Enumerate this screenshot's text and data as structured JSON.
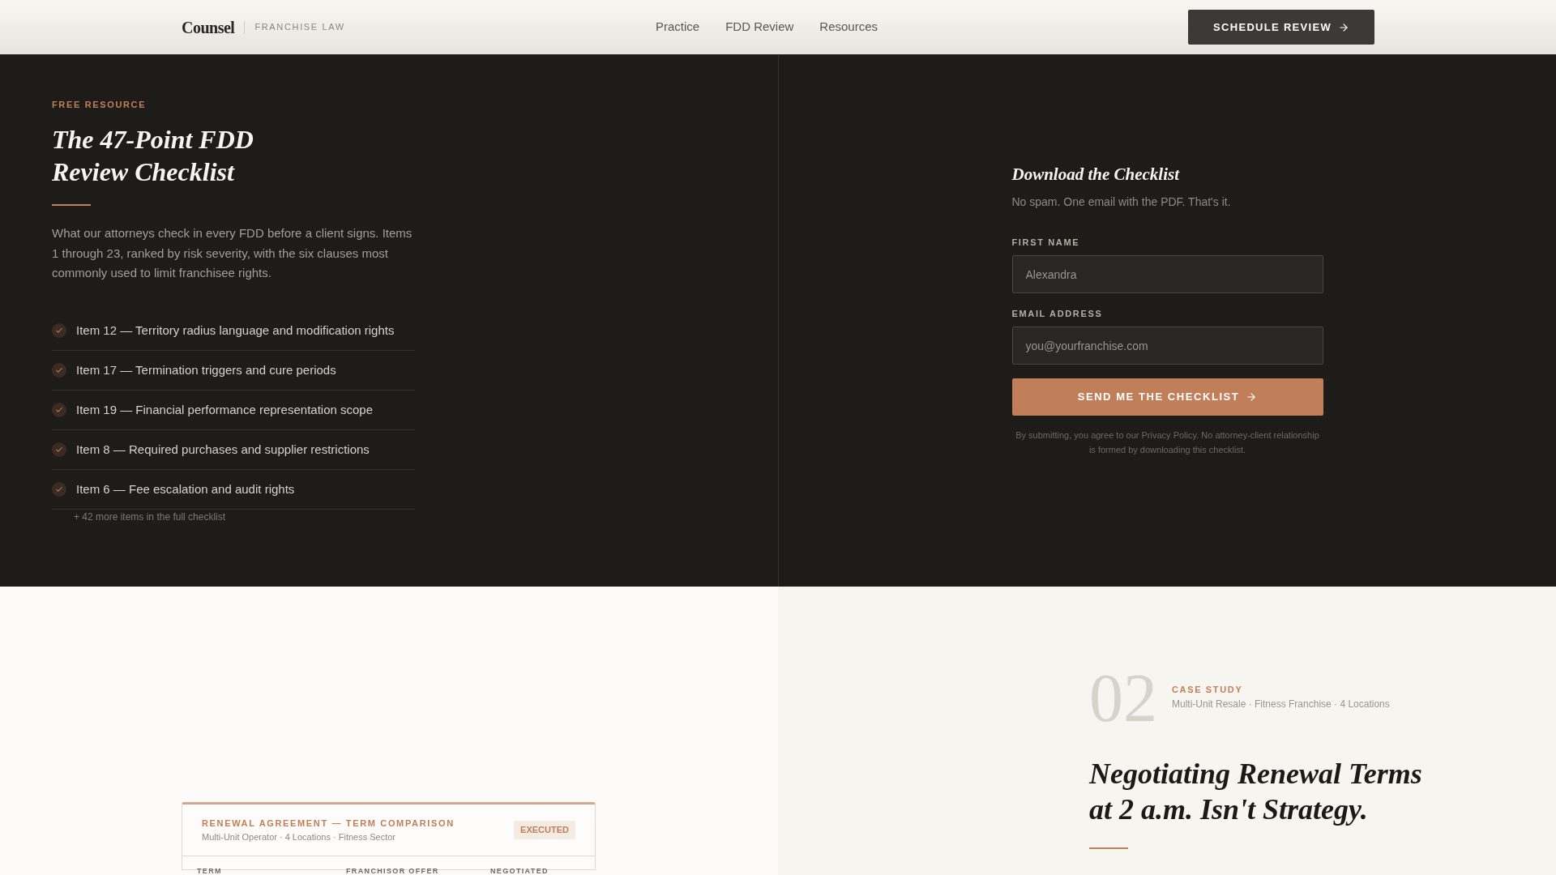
{
  "header": {
    "logo": "Counsel",
    "tagline": "FRANCHISE LAW",
    "nav": [
      {
        "label": "Practice"
      },
      {
        "label": "FDD Review"
      },
      {
        "label": "Resources"
      }
    ],
    "cta": "SCHEDULE REVIEW"
  },
  "checklist": {
    "eyebrow": "FREE RESOURCE",
    "title": "The 47-Point FDD Review Checklist",
    "description": "What our attorneys check in every FDD before a client signs. Items 1 through 23, ranked by risk severity, with the six clauses most commonly used to limit franchisee rights.",
    "items": [
      {
        "text": "Item 12 — Territory radius language and modification rights"
      },
      {
        "text": "Item 17 — Termination triggers and cure periods"
      },
      {
        "text": "Item 19 — Financial performance representation scope"
      },
      {
        "text": "Item 8 — Required purchases and supplier restrictions"
      },
      {
        "text": "Item 6 — Fee escalation and audit rights"
      }
    ],
    "more": "+ 42 more items in the full checklist"
  },
  "form": {
    "title": "Download the Checklist",
    "subtitle": "No spam. One email with the PDF. That's it.",
    "fields": [
      {
        "label": "FIRST NAME",
        "placeholder": "Alexandra"
      },
      {
        "label": "EMAIL ADDRESS",
        "placeholder": "you@yourfranchise.com"
      }
    ],
    "submit": "SEND ME THE CHECKLIST",
    "disclaimer": "By submitting, you agree to our Privacy Policy. No attorney-client relationship is formed by downloading this checklist."
  },
  "agreement_card": {
    "title": "RENEWAL AGREEMENT — TERM COMPARISON",
    "subtitle": "Multi-Unit Operator · 4 Locations · Fitness Sector",
    "badge": "EXECUTED",
    "columns": [
      "TERM",
      "FRANCHISOR OFFER",
      "NEGOTIATED"
    ]
  },
  "case_study": {
    "number": "02",
    "eyebrow": "CASE STUDY",
    "meta": "Multi-Unit Resale · Fitness Franchise · 4 Locations",
    "title": "Negotiating Renewal Terms at 2 a.m. Isn't Strategy."
  }
}
